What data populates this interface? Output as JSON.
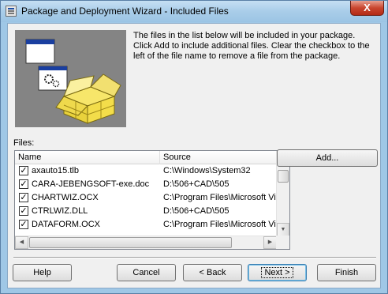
{
  "window": {
    "title": "Package and Deployment Wizard - Included Files",
    "close_glyph": "X"
  },
  "description": "The files in the list below will be included in your package. Click Add to include additional files. Clear the checkbox to the left of the file name to remove a file from the package.",
  "files_label": "Files:",
  "list": {
    "columns": [
      "Name",
      "Source"
    ],
    "rows": [
      {
        "checked": true,
        "name": "axauto15.tlb",
        "source": "C:\\Windows\\System32"
      },
      {
        "checked": true,
        "name": "CARA-JEBENGSOFT-exe.doc",
        "source": "D:\\506+CAD\\505"
      },
      {
        "checked": true,
        "name": "CHARTWIZ.OCX",
        "source": "C:\\Program Files\\Microsoft Vis"
      },
      {
        "checked": true,
        "name": "CTRLWIZ.DLL",
        "source": "D:\\506+CAD\\505"
      },
      {
        "checked": true,
        "name": "DATAFORM.OCX",
        "source": "C:\\Program Files\\Microsoft Vis"
      }
    ]
  },
  "buttons": {
    "add": "Add...",
    "help": "Help",
    "cancel": "Cancel",
    "back": "< Back",
    "next": "Next >",
    "finish": "Finish"
  },
  "check_glyph": "✓"
}
